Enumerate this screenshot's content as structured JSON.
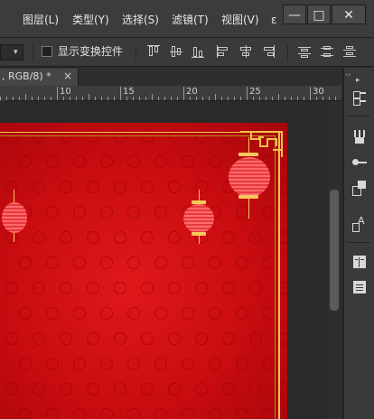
{
  "menubar": {
    "items": [
      "图层(L)",
      "类型(Y)",
      "选择(S)",
      "滤镜(T)",
      "视图(V)"
    ],
    "more": "ε"
  },
  "window_controls": {
    "minimize": "—",
    "restore": "□",
    "close": "✕"
  },
  "options_bar": {
    "show_transform_controls_label": "显示变换控件",
    "show_transform_controls_checked": false,
    "align_icons": [
      "align-top-edges-icon",
      "align-vertical-centers-icon",
      "align-bottom-edges-icon",
      "align-left-edges-icon",
      "align-horizontal-centers-icon",
      "align-right-edges-icon"
    ],
    "distribute_icons": [
      "distribute-top-icon",
      "distribute-vcenter-icon",
      "distribute-bottom-icon"
    ]
  },
  "document_tab": {
    "title": ", RGB/8) *",
    "close": "×"
  },
  "ruler": {
    "labels": [
      "10",
      "15",
      "20",
      "25",
      "30"
    ]
  },
  "right_panel": {
    "icons": [
      "history-icon",
      "brush-presets-icon",
      "brush-icon",
      "clone-source-icon",
      "character-icon",
      "paragraph-icon",
      "layer-comps-icon"
    ]
  },
  "colors": {
    "canvas_red": "#c80c10",
    "gold_border": "#f2c24b",
    "lantern": "#ff6b6d",
    "ui_dark": "#3a3a3a"
  }
}
